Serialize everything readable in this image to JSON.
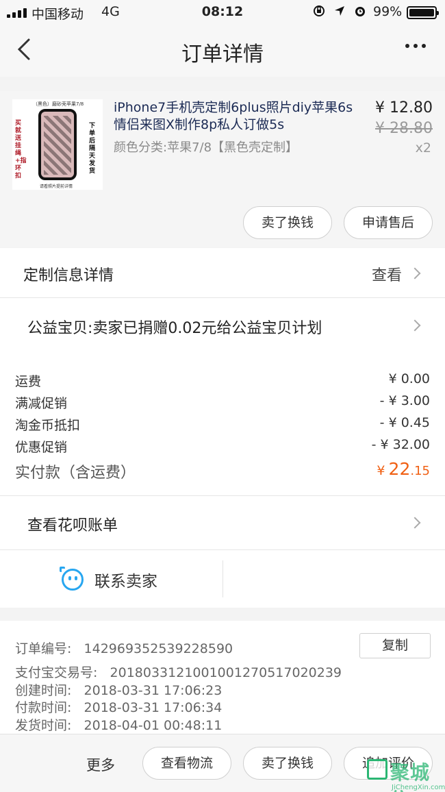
{
  "status_bar": {
    "carrier": "中国移动",
    "network": "4G",
    "time": "08:12",
    "battery_pct": "99%",
    "icons": [
      "orientation-lock-icon",
      "location-arrow-icon",
      "alarm-icon"
    ]
  },
  "nav": {
    "title": "订单详情",
    "back_icon": "chevron-left-icon",
    "more_icon": "more-dots-icon"
  },
  "product": {
    "title": "iPhone7手机壳定制6plus照片diy苹果6s情侣来图X制作8p私人订做5s",
    "sku": "颜色分类:苹果7/8【黑色壳定制】",
    "price": "¥ 12.80",
    "original_price": "¥ 28.80",
    "quantity": "x2",
    "thumb_text": {
      "top": "（黑色）磨砂壳苹果7/8",
      "left": "买就送挂绳+指环扣",
      "right": "下单后隔天发货",
      "bottom": "请看照片提前详情"
    },
    "buttons": [
      "卖了换钱",
      "申请售后"
    ]
  },
  "custom_info": {
    "label": "定制信息详情",
    "action": "查看"
  },
  "charity": {
    "label": "公益宝贝:卖家已捐赠0.02元给公益宝贝计划"
  },
  "fees": [
    {
      "label": "运费",
      "value": "¥ 0.00"
    },
    {
      "label": "满减促销",
      "value": "- ¥ 3.00"
    },
    {
      "label": "淘金币抵扣",
      "value": "- ¥ 0.45"
    },
    {
      "label": "优惠促销",
      "value": "- ¥ 32.00"
    }
  ],
  "paid": {
    "label": "实付款（含运费）",
    "currency": "¥",
    "integer": "22",
    "decimal": ".15"
  },
  "huabei": {
    "label": "查看花呗账单"
  },
  "contact": {
    "label": "联系卖家",
    "icon": "customer-service-icon"
  },
  "order_info": {
    "order_no_label": "订单编号:",
    "order_no": "142969352539228590",
    "copy_label": "复制",
    "alipay_label": "支付宝交易号:",
    "alipay_no": "2018033121001001270517020239",
    "created_label": "创建时间:",
    "created": "2018-03-31 17:06:23",
    "paid_label": "付款时间:",
    "paid_time": "2018-03-31 17:06:34",
    "shipped_label": "发货时间:",
    "shipped": "2018-04-01 00:48:11"
  },
  "bottom_bar": {
    "more_label": "更多",
    "buttons": [
      "查看物流",
      "卖了换钱",
      "追加评价"
    ]
  },
  "watermark": {
    "text": "聚城信",
    "url": "JiChengXin.com"
  }
}
